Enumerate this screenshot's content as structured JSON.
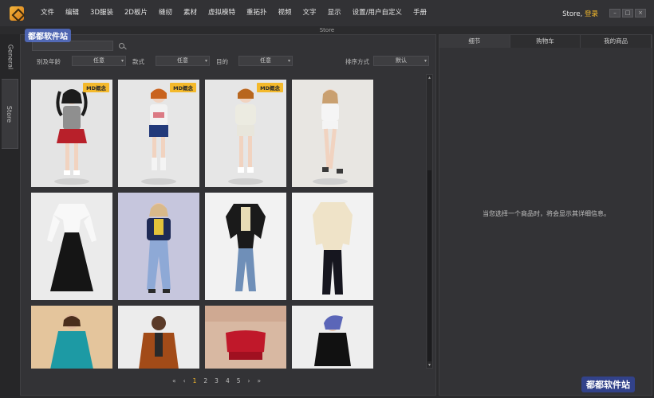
{
  "menu": {
    "items": [
      "文件",
      "编辑",
      "3D服装",
      "2D板片",
      "缝纫",
      "素材",
      "虚拟模特",
      "重拓扑",
      "视频",
      "文字",
      "显示",
      "设置/用户自定义",
      "手册"
    ],
    "store_prefix": "Store,",
    "login_label": "登录"
  },
  "window": {
    "title": "Store"
  },
  "left_tabs": {
    "general": "General",
    "store": "Store"
  },
  "search": {
    "value": "",
    "placeholder": ""
  },
  "filters": {
    "gender_age_label": "别及年龄",
    "gender_age_value": "任意",
    "style_label": "款式",
    "style_value": "任意",
    "purpose_label": "目的",
    "purpose_value": "任意",
    "sort_label": "排序方式",
    "sort_value": "默认"
  },
  "products": [
    {
      "badge": "MD概念"
    },
    {
      "badge": "MD概念"
    },
    {
      "badge": "MD概念"
    },
    {
      "badge": ""
    },
    {
      "badge": ""
    },
    {
      "badge": ""
    },
    {
      "badge": ""
    },
    {
      "badge": ""
    },
    {
      "badge": ""
    },
    {
      "badge": ""
    },
    {
      "badge": ""
    },
    {
      "badge": ""
    }
  ],
  "pagination": {
    "first": "«",
    "prev": "‹",
    "pages": [
      "1",
      "2",
      "3",
      "4",
      "5"
    ],
    "current": "1",
    "next": "›",
    "last": "»"
  },
  "right_panel": {
    "tabs": [
      "细节",
      "购物车",
      "我的商品"
    ],
    "empty_hint": "当您选择一个商品时，将会显示其详细信息。"
  },
  "watermarks": {
    "top_left": "都都软件站",
    "bottom_right": "都都软件站"
  },
  "colors": {
    "accent": "#f4b92b",
    "bg": "#2b2b2d",
    "panel": "#333336"
  }
}
